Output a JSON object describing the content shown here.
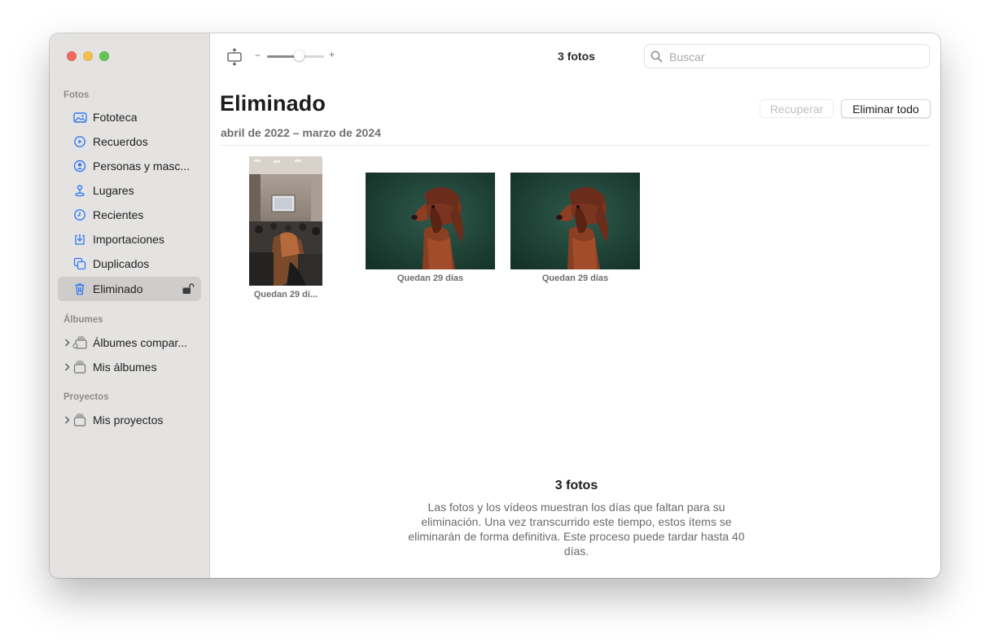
{
  "sidebar": {
    "sections": {
      "photos": "Fotos",
      "albums": "Álbumes",
      "projects": "Proyectos"
    },
    "photo_items": [
      {
        "label": "Fototeca",
        "icon": "photo-library-icon"
      },
      {
        "label": "Recuerdos",
        "icon": "memories-icon"
      },
      {
        "label": "Personas y masc...",
        "icon": "people-icon"
      },
      {
        "label": "Lugares",
        "icon": "places-icon"
      },
      {
        "label": "Recientes",
        "icon": "recents-icon"
      },
      {
        "label": "Importaciones",
        "icon": "imports-icon"
      },
      {
        "label": "Duplicados",
        "icon": "duplicates-icon"
      },
      {
        "label": "Eliminado",
        "icon": "trash-icon",
        "selected": true
      }
    ],
    "album_items": [
      {
        "label": "Álbumes compar...",
        "icon": "shared-albums-icon"
      },
      {
        "label": "Mis álbumes",
        "icon": "albums-folder-icon"
      }
    ],
    "project_items": [
      {
        "label": "Mis proyectos",
        "icon": "projects-folder-icon"
      }
    ]
  },
  "toolbar": {
    "zoom_minus": "−",
    "zoom_plus": "+",
    "zoom_level": 0.55,
    "count_title": "3 fotos",
    "search_placeholder": "Buscar"
  },
  "main": {
    "title": "Eliminado",
    "subtitle": "abril de 2022 – marzo de 2024",
    "recover_label": "Recuperar",
    "delete_all_label": "Eliminar todo",
    "photos": [
      {
        "caption": "Quedan 29 dí...",
        "kind": "conference-room-photo"
      },
      {
        "caption": "Quedan 29 días",
        "kind": "dog-photo"
      },
      {
        "caption": "Quedan 29 días",
        "kind": "dog-photo"
      }
    ],
    "info_title": "3 fotos",
    "info_text": "Las fotos y los vídeos muestran los días que faltan para su eliminación. Una vez transcurrido este tiempo, estos ítems se eliminarán de forma definitiva. Este proceso puede tardar hasta 40 días."
  },
  "colors": {
    "accent": "#3478f6",
    "sidebar_bg": "#e4e3e2",
    "selected_bg": "#cfcdcb",
    "close": "#ed6a5e",
    "minimize": "#f5bf4f",
    "maximize": "#61c554"
  }
}
